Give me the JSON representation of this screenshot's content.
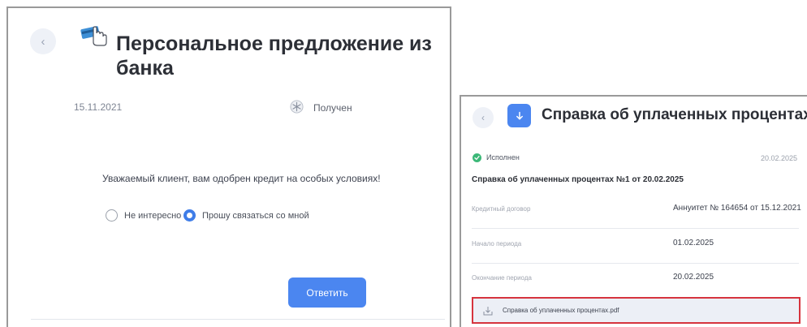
{
  "left": {
    "back_icon": "chevron-left-icon",
    "back_glyph": "‹",
    "offer_icon": "hand-card-icon",
    "title": "Персональное предложение из банка",
    "date": "15.11.2021",
    "status_icon": "snowflake-status-icon",
    "status": "Получен",
    "message": "Уважаемый клиент, вам одобрен кредит на особых условиях!",
    "options": [
      {
        "label": "Не интересно",
        "selected": false
      },
      {
        "label": "Прошу связаться со мной",
        "selected": true
      }
    ],
    "reply_label": "Ответить",
    "colors": {
      "accent": "#4b86f0",
      "radio_selected": "#3f7de8",
      "panel_border": "#9a9a9a"
    }
  },
  "right": {
    "back_icon": "chevron-left-icon",
    "back_glyph": "‹",
    "title_icon": "download-icon",
    "title": "Справка об уплаченных процентах",
    "status": "Исполнен",
    "status_icon": "check-circle-icon",
    "date": "20.02.2025",
    "doc_title": "Справка об уплаченных процентах №1 от 20.02.2025",
    "rows": [
      {
        "label": "Кредитный договор",
        "value": "Аннуитет № 164654 от 15.12.2021"
      },
      {
        "label": "Начало периода",
        "value": "01.02.2025"
      },
      {
        "label": "Окончание периода",
        "value": "20.02.2025"
      }
    ],
    "file": {
      "icon": "file-download-icon",
      "name": "Справка об уплаченных процентах.pdf"
    },
    "colors": {
      "accent": "#4b86f0",
      "status_ok": "#3cb878",
      "highlight_border": "#d6343e",
      "file_bg": "#eceff6"
    }
  }
}
